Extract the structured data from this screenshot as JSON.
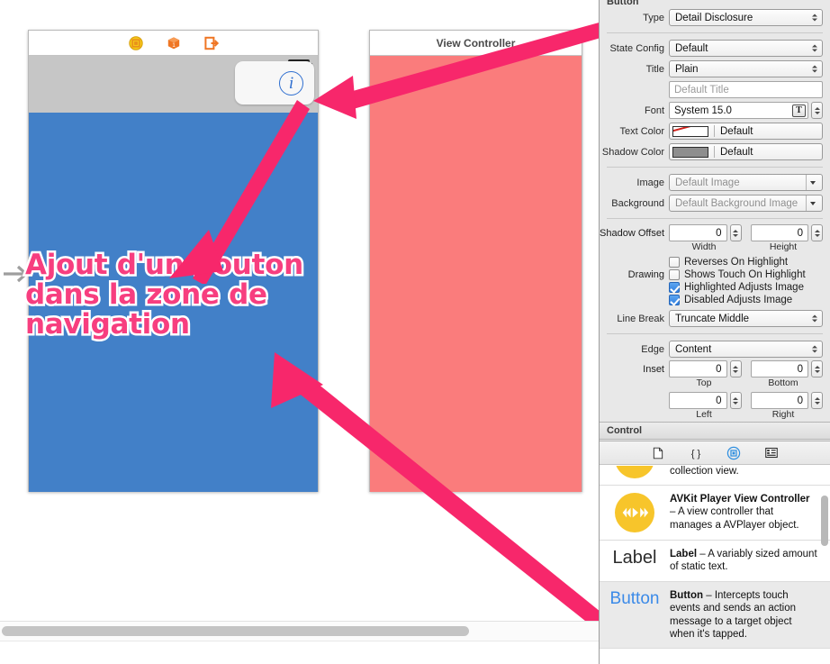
{
  "canvas": {
    "entry_arrow": "entry-point-arrow",
    "scene_blue": {
      "dock_icons": [
        "view-controller-icon",
        "first-responder-icon",
        "exit-icon"
      ],
      "selected_button_glyph": "i",
      "selected_button_name": "detail-disclosure-button",
      "nav_bar_color": "#c6c6c6",
      "body_color": "#4280c8"
    },
    "scene_red": {
      "title": "View Controller",
      "body_color": "#fa7c7c"
    },
    "annotation": {
      "line1": "Ajout d'un bouton",
      "line2": "dans la zone de",
      "line3": "navigation",
      "color": "#f73e7f",
      "outline_color": "#ffffff"
    },
    "arrow_color": "#f7276b"
  },
  "inspector": {
    "section_title": "Button",
    "rows": {
      "type": {
        "label": "Type",
        "value": "Detail Disclosure"
      },
      "state_config": {
        "label": "State Config",
        "value": "Default"
      },
      "title_style": {
        "label": "Title",
        "value": "Plain"
      },
      "title_text": {
        "label": "",
        "placeholder": "Default Title",
        "value": ""
      },
      "font": {
        "label": "Font",
        "value": "System 15.0",
        "icon": "font-picker-icon"
      },
      "text_color": {
        "label": "Text Color",
        "value": "Default",
        "swatch": "#ffffff",
        "slash": "#d0211a"
      },
      "shadow_color": {
        "label": "Shadow Color",
        "value": "Default",
        "swatch": "#8e8e8e"
      },
      "image": {
        "label": "Image",
        "placeholder": "Default Image"
      },
      "background": {
        "label": "Background",
        "placeholder": "Default Background Image"
      },
      "shadow_offset": {
        "label": "Shadow Offset",
        "width_value": "0",
        "width_caption": "Width",
        "height_value": "0",
        "height_caption": "Height"
      },
      "drawing": {
        "label": "Drawing",
        "options": [
          {
            "label": "Reverses On Highlight",
            "checked": false
          },
          {
            "label": "Shows Touch On Highlight",
            "checked": false
          },
          {
            "label": "Highlighted Adjusts Image",
            "checked": true
          },
          {
            "label": "Disabled Adjusts Image",
            "checked": true
          }
        ]
      },
      "line_break": {
        "label": "Line Break",
        "value": "Truncate Middle"
      },
      "edge": {
        "label": "Edge",
        "value": "Content"
      },
      "inset": {
        "label": "Inset",
        "top_value": "0",
        "top_caption": "Top",
        "bottom_value": "0",
        "bottom_caption": "Bottom",
        "left_value": "0",
        "left_caption": "Left",
        "right_value": "0",
        "right_caption": "Right"
      }
    },
    "control_section_title": "Control"
  },
  "library": {
    "tabs": [
      {
        "name": "file-template-library-icon",
        "selected": false
      },
      {
        "name": "code-snippet-library-icon",
        "selected": false
      },
      {
        "name": "object-library-icon",
        "selected": true
      },
      {
        "name": "media-library-icon",
        "selected": false
      }
    ],
    "items": [
      {
        "icon": "round-yellow-icon",
        "title": "",
        "desc": "collection view.",
        "partial": true,
        "selected": false
      },
      {
        "icon": "avkit-player-icon",
        "title": "AVKit Player View Controller",
        "desc": " – A view controller that manages a AVPlayer object.",
        "partial": false,
        "selected": false
      },
      {
        "icon": "label-icon",
        "icon_text": "Label",
        "title": "Label",
        "desc": " – A variably sized amount of static text.",
        "partial": false,
        "selected": false
      },
      {
        "icon": "button-icon",
        "icon_text": "Button",
        "title": "Button",
        "desc": " – Intercepts touch events and sends an action message to a target object when it's tapped.",
        "partial": false,
        "selected": true
      }
    ]
  }
}
